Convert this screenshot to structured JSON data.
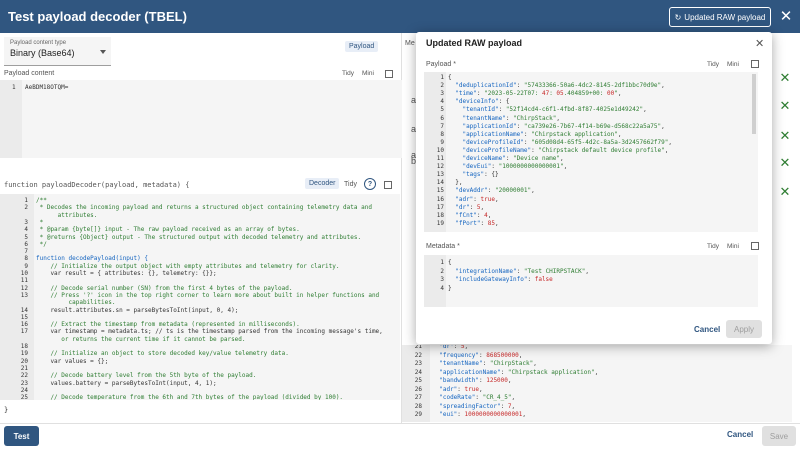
{
  "header": {
    "title": "Test payload decoder (TBEL)",
    "updated_btn": "Updated RAW payload",
    "refresh_icon": "↻",
    "close_icon": "✕"
  },
  "left": {
    "ptype_label": "Payload content type",
    "ptype_value": "Binary (Base64)",
    "payload_chip": "Payload",
    "payload_content_label": "Payload content",
    "tidy": "Tidy",
    "mini": "Mini",
    "payload_value": "AeBDM18OTQM=",
    "decoder_label": "function payloadDecoder(payload, metadata) {",
    "decoder_chip": "Decoder",
    "help": "?",
    "closing_brace": "}"
  },
  "decoder_code": [
    {
      "n": "1",
      "t": "/**",
      "c": "c-cm"
    },
    {
      "n": "2",
      "t": " * Decodes the incoming payload and returns a structured object containing telemetry data and",
      "c": "c-cm"
    },
    {
      "n": "",
      "t": "      attributes.",
      "c": "c-cm"
    },
    {
      "n": "3",
      "t": " *",
      "c": "c-cm"
    },
    {
      "n": "4",
      "t": " * @param {byte[]} input - The raw payload received as an array of bytes.",
      "c": "c-cm"
    },
    {
      "n": "5",
      "t": " * @returns {Object} output - The structured output with decoded telemetry and attributes.",
      "c": "c-cm"
    },
    {
      "n": "6",
      "t": " */",
      "c": "c-cm"
    },
    {
      "n": "7",
      "t": "",
      "c": "c-tx"
    },
    {
      "n": "8",
      "t": "function decodePayload(input) {",
      "c": "c-fn"
    },
    {
      "n": "9",
      "t": "    // Initialize the output object with empty attributes and telemetry for clarity.",
      "c": "c-cm"
    },
    {
      "n": "10",
      "t": "    var result = { attributes: {}, telemetry: {}};",
      "c": "c-tx"
    },
    {
      "n": "11",
      "t": "",
      "c": "c-tx"
    },
    {
      "n": "12",
      "t": "    // Decode serial number (SN) from the first 4 bytes of the payload.",
      "c": "c-cm"
    },
    {
      "n": "13",
      "t": "    // Press '?' icon in the top right corner to learn more about built in helper functions and",
      "c": "c-cm"
    },
    {
      "n": "",
      "t": "         capabilities.",
      "c": "c-cm"
    },
    {
      "n": "14",
      "t": "    result.attributes.sn = parseBytesToInt(input, 0, 4);",
      "c": "c-tx"
    },
    {
      "n": "15",
      "t": "",
      "c": "c-tx"
    },
    {
      "n": "16",
      "t": "    // Extract the timestamp from metadata (represented in milliseconds).",
      "c": "c-cm"
    },
    {
      "n": "17",
      "t": "    var timestamp = metadata.ts; // ts is the timestamp parsed from the incoming message's time,",
      "c": "c-tx"
    },
    {
      "n": "",
      "t": "       or returns the current time if it cannot be parsed.",
      "c": "c-cm"
    },
    {
      "n": "18",
      "t": "",
      "c": "c-tx"
    },
    {
      "n": "19",
      "t": "    // Initialize an object to store decoded key/value telemetry data.",
      "c": "c-cm"
    },
    {
      "n": "20",
      "t": "    var values = {};",
      "c": "c-tx"
    },
    {
      "n": "21",
      "t": "",
      "c": "c-tx"
    },
    {
      "n": "22",
      "t": "    // Decode battery level from the 5th byte of the payload.",
      "c": "c-cm"
    },
    {
      "n": "23",
      "t": "    values.battery = parseBytesToInt(input, 4, 1);",
      "c": "c-tx"
    },
    {
      "n": "24",
      "t": "",
      "c": "c-tx"
    },
    {
      "n": "25",
      "t": "    // Decode temperature from the 6th and 7th bytes of the payload (divided by 100).",
      "c": "c-cm"
    }
  ],
  "right_bg": {
    "letters": [
      "Me",
      "a",
      "a",
      "a",
      "b"
    ],
    "lines": [
      {
        "n": "21",
        "t": "  \"dr\": 5,"
      },
      {
        "n": "22",
        "t": "  \"frequency\": 868500000,"
      },
      {
        "n": "23",
        "t": "  \"tenantName\": \"ChirpStack\","
      },
      {
        "n": "24",
        "t": "  \"applicationName\": \"Chirpstack application\","
      },
      {
        "n": "25",
        "t": "  \"bandwidth\": 125000,"
      },
      {
        "n": "26",
        "t": "  \"adr\": true,"
      },
      {
        "n": "27",
        "t": "  \"codeRate\": \"CR_4_5\","
      },
      {
        "n": "28",
        "t": "  \"spreadingFactor\": 7,"
      },
      {
        "n": "29",
        "t": "  \"eui\": 1000000000000001,"
      }
    ],
    "partial_top": "  \"fPort\": 85,"
  },
  "footer": {
    "test": "Test",
    "cancel": "Cancel",
    "save": "Save"
  },
  "modal": {
    "title": "Updated RAW payload",
    "close": "✕",
    "payload_label": "Payload *",
    "metadata_label": "Metadata *",
    "tidy": "Tidy",
    "mini": "Mini",
    "cancel": "Cancel",
    "apply": "Apply",
    "payload_lines": [
      {
        "n": "1",
        "t": "{"
      },
      {
        "n": "2",
        "t": "  \"deduplicationId\": \"57433366-50a6-4dc2-8145-2df1bbc70d9e\","
      },
      {
        "n": "3",
        "t": "  \"time\": \"2023-05-22T07:47:05.404859+00:00\","
      },
      {
        "n": "4",
        "t": "  \"deviceInfo\": {"
      },
      {
        "n": "5",
        "t": "    \"tenantId\": \"52f14cd4-c6f1-4fbd-8f87-4025e1d49242\","
      },
      {
        "n": "6",
        "t": "    \"tenantName\": \"ChirpStack\","
      },
      {
        "n": "7",
        "t": "    \"applicationId\": \"ca739e26-7b67-4f14-b69e-d568c22a5a75\","
      },
      {
        "n": "8",
        "t": "    \"applicationName\": \"Chirpstack application\","
      },
      {
        "n": "9",
        "t": "    \"deviceProfileId\": \"605d08d4-65f5-4d2c-8a5a-3d2457662f79\","
      },
      {
        "n": "10",
        "t": "    \"deviceProfileName\": \"Chirpstack default device profile\","
      },
      {
        "n": "11",
        "t": "    \"deviceName\": \"Device name\","
      },
      {
        "n": "12",
        "t": "    \"devEui\": \"1000000000000001\","
      },
      {
        "n": "13",
        "t": "    \"tags\": {}"
      },
      {
        "n": "14",
        "t": "  },"
      },
      {
        "n": "15",
        "t": "  \"devAddr\": \"20000001\","
      },
      {
        "n": "16",
        "t": "  \"adr\": true,"
      },
      {
        "n": "17",
        "t": "  \"dr\": 5,"
      },
      {
        "n": "18",
        "t": "  \"fCnt\": 4,"
      },
      {
        "n": "19",
        "t": "  \"fPort\": 85,"
      }
    ],
    "metadata_lines": [
      {
        "n": "1",
        "t": "{"
      },
      {
        "n": "2",
        "t": "  \"integrationName\": \"Test CHIRPSTACK\","
      },
      {
        "n": "3",
        "t": "  \"includeGatewayInfo\": false"
      },
      {
        "n": "4",
        "t": "}"
      }
    ]
  },
  "colors": {
    "primary": "#305680",
    "accent_green": "#2e7d32"
  }
}
